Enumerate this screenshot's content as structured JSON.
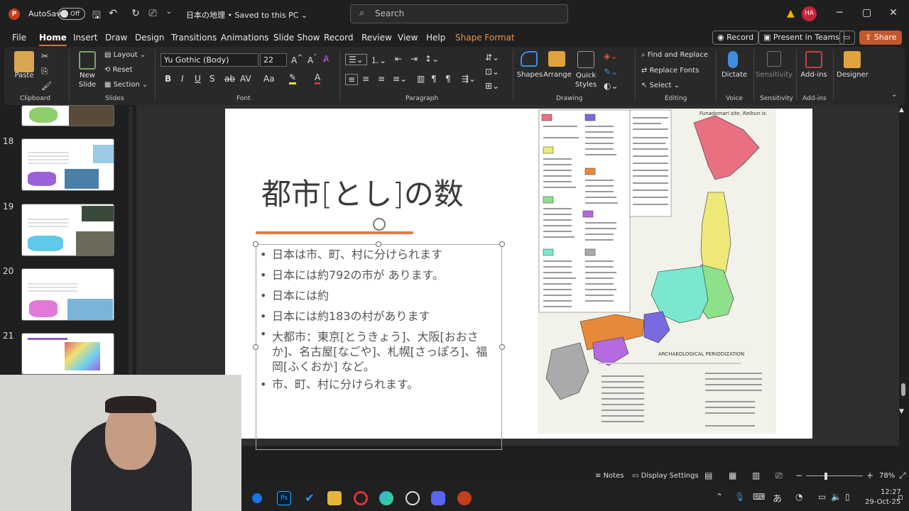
{
  "titlebar": {
    "app_icon": "P",
    "autosave_label": "AutoSave",
    "autosave_state": "Off",
    "doc_title": "日本の地理 • Saved to this PC ⌄",
    "search_placeholder": "Search",
    "user_initials": "HA"
  },
  "menu": {
    "items": [
      "File",
      "Home",
      "Insert",
      "Draw",
      "Design",
      "Transitions",
      "Animations",
      "Slide Show",
      "Record",
      "Review",
      "View",
      "Help",
      "Shape Format"
    ],
    "active": "Home",
    "record_btn": "Record",
    "present_btn": "Present in Teams",
    "share_btn": "Share"
  },
  "ribbon": {
    "clipboard": {
      "paste": "Paste",
      "label": "Clipboard"
    },
    "slides": {
      "new_slide": "New Slide",
      "layout": "Layout",
      "reset": "Reset",
      "section": "Section",
      "label": "Slides"
    },
    "font": {
      "name": "Yu Gothic (Body)",
      "size": "22",
      "label": "Font"
    },
    "paragraph": {
      "label": "Paragraph"
    },
    "drawing": {
      "shapes": "Shapes",
      "arrange": "Arrange",
      "quick_styles": "Quick Styles",
      "label": "Drawing"
    },
    "editing": {
      "find_replace": "Find and Replace",
      "replace_fonts": "Replace Fonts",
      "select": "Select",
      "label": "Editing"
    },
    "voice": {
      "dictate": "Dictate",
      "label": "Voice"
    },
    "sensitivity": {
      "btn": "Sensitivity",
      "label": "Sensitivity"
    },
    "addins": {
      "btn": "Add-ins",
      "label": "Add-ins"
    },
    "designer": {
      "btn": "Designer"
    }
  },
  "slides_panel": {
    "numbers": [
      "18",
      "19",
      "20",
      "21"
    ]
  },
  "slide": {
    "title": "都市[とし]の数",
    "bullets": [
      "日本は市、町、村に分けられます",
      "日本には約792の市が あります。",
      "日本には約",
      "日本には約183の村があります",
      "大都市：東京[とうきょう]、大阪[おおさか]、名古屋[なごや]、札幌[さっぽろ]、福岡[ふくおか] など。",
      "市、町、村に分けられます。"
    ],
    "map_caption_top": "Funadomari site, Reibun Is.",
    "map_footer": "ARCHAEOLOGICAL PERIODIZATION"
  },
  "statusbar": {
    "notes": "Notes",
    "display_settings": "Display Settings",
    "zoom": "78%"
  },
  "taskbar": {
    "time": "12:27",
    "date": "29-Oct-25",
    "ime": "あ"
  }
}
